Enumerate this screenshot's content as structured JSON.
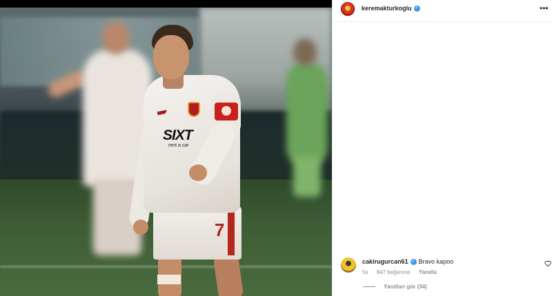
{
  "post": {
    "author": {
      "username": "keremakturkoglu",
      "verified": true
    },
    "menu_icon": "more-horizontal-icon",
    "photo": {
      "sponsor_text": "SIXT",
      "sponsor_sub": "rent a car",
      "shirt_number": "7"
    }
  },
  "comments": [
    {
      "username": "cakirugurcan61",
      "verified": true,
      "text": "Bravo kapoo",
      "time": "5s",
      "likes": "847 beğenme",
      "reply_label": "Yanıtla",
      "view_replies": "Yanıtları gör (34)",
      "like_icon": "heart-outline-icon"
    }
  ],
  "colors": {
    "verified_blue": "#3897f0",
    "text_primary": "#262626",
    "text_secondary": "#8e8e8e"
  }
}
